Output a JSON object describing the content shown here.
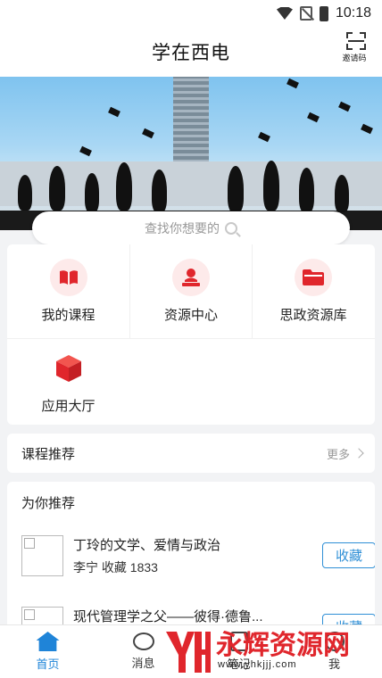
{
  "status_bar": {
    "time": "10:18",
    "icons": [
      "wifi-icon",
      "no-sim-icon",
      "battery-icon"
    ]
  },
  "header": {
    "title": "学在西电",
    "invite_label": "邀请码",
    "invite_icon": "scan-icon"
  },
  "search": {
    "placeholder": "查找你想要的",
    "icon": "search-icon"
  },
  "menu": [
    {
      "label": "我的课程",
      "icon": "book-icon"
    },
    {
      "label": "资源中心",
      "icon": "person-desk-icon"
    },
    {
      "label": "思政资源库",
      "icon": "folder-icon"
    },
    {
      "label": "应用大厅",
      "icon": "cube-icon"
    }
  ],
  "recommend": {
    "title": "课程推荐",
    "more": "更多"
  },
  "for_you": {
    "title": "为你推荐",
    "courses": [
      {
        "name": "丁玲的文学、爱情与政治",
        "meta": "李宁 收藏 1833",
        "action": "收藏"
      },
      {
        "name": "现代管理学之父——彼得·德鲁...",
        "meta": "",
        "action": "收藏"
      }
    ]
  },
  "tabs": [
    {
      "label": "首页",
      "icon": "home-icon",
      "active": true
    },
    {
      "label": "消息",
      "icon": "message-icon"
    },
    {
      "label": "笔记",
      "icon": "note-icon"
    },
    {
      "label": "我",
      "icon": "profile-icon"
    }
  ],
  "watermark": {
    "text": "永辉资源网",
    "url": "www.yhkjjj.com"
  },
  "colors": {
    "accent": "#1f84d8",
    "brand_red": "#e0262c"
  }
}
